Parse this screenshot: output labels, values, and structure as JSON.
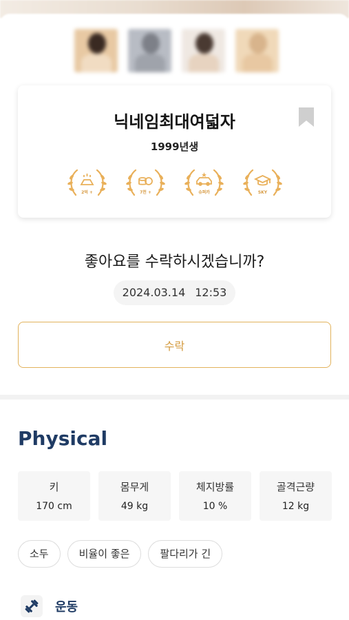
{
  "profile": {
    "nickname": "닉네임최대여덟자",
    "birth_year": "1999년생",
    "badges": [
      {
        "icon": "gold-bar-icon",
        "label": "2억 +"
      },
      {
        "icon": "coins-icon",
        "label": "7천 +"
      },
      {
        "icon": "car-icon",
        "label": "슈퍼카"
      },
      {
        "icon": "graduation-cap-icon",
        "label": "SKY"
      }
    ]
  },
  "request": {
    "question": "좋아요를 수락하시겠습니까?",
    "date": "2024.03.14",
    "time": "12:53",
    "accept_label": "수락"
  },
  "physical": {
    "title": "Physical",
    "stats": [
      {
        "label": "키",
        "value": "170 cm"
      },
      {
        "label": "몸무게",
        "value": "49 kg"
      },
      {
        "label": "체지방률",
        "value": "10 %"
      },
      {
        "label": "골격근량",
        "value": "12 kg"
      }
    ],
    "tags": [
      "소두",
      "비율이 좋은",
      "팔다리가 긴"
    ]
  },
  "exercise": {
    "label": "운동",
    "icon": "dumbbell-icon"
  },
  "colors": {
    "accent": "#e2b25b",
    "accent_text": "#d39a3e",
    "navy": "#1f3b64",
    "badge_gold": "#e9b05a"
  }
}
